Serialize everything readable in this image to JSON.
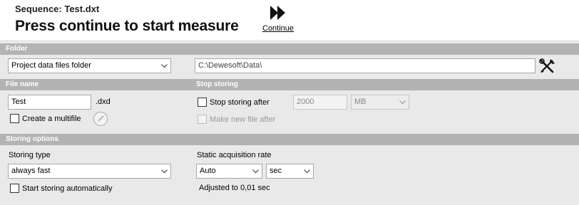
{
  "header": {
    "sequence": "Sequence: Test.dxt",
    "title": "Press continue to start measure",
    "continue_label": "Continue"
  },
  "folder": {
    "section_title": "Folder",
    "folder_type": "Project data files folder",
    "path": "C:\\Dewesoft\\Data\\"
  },
  "file_name": {
    "section_title": "File name",
    "value": "Test",
    "extension": ".dxd",
    "multifile_label": "Create a multifile"
  },
  "stop_storing": {
    "section_title": "Stop storing",
    "stop_after_label": "Stop storing after",
    "amount": "2000",
    "unit": "MB",
    "new_file_label": "Make new file after"
  },
  "storing_options": {
    "section_title": "Storing options",
    "storing_type_label": "Storing type",
    "storing_type": "always fast",
    "auto_start_label": "Start storing automatically",
    "static_rate_label": "Static acquisition rate",
    "rate": "Auto",
    "rate_unit": "sec",
    "adjusted_text": "Adjusted to 0,01 sec"
  }
}
